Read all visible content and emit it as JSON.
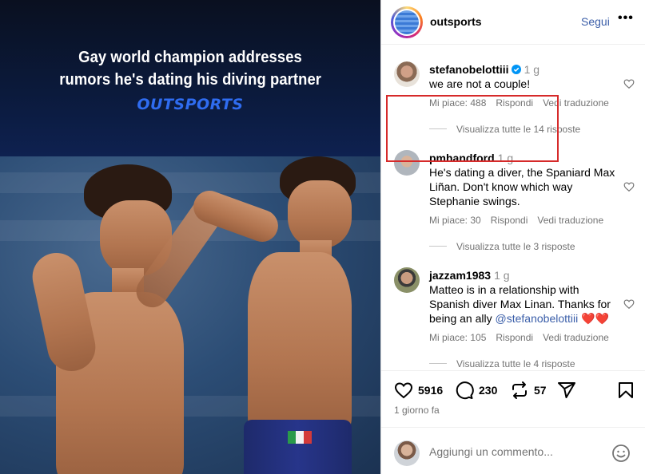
{
  "media": {
    "headline_line1": "Gay world champion addresses",
    "headline_line2": "rumors he's dating his diving partner",
    "brand": "OUTSPORTS"
  },
  "post": {
    "owner": "outsports",
    "follow_label": "Segui",
    "more_label": "•••"
  },
  "comments": [
    {
      "user": "stefanobelottiii",
      "verified": true,
      "time": "1 g",
      "text": "we are not a couple!",
      "likes": "Mi piace: 488",
      "reply": "Rispondi",
      "translate": "Vedi traduzione",
      "view_replies": "Visualizza tutte le 14 risposte"
    },
    {
      "user": "pmhandford",
      "verified": false,
      "time": "1 g",
      "text": "He's dating a diver, the Spaniard Max Liñan. Don't know which way Stephanie swings.",
      "likes": "Mi piace: 30",
      "reply": "Rispondi",
      "translate": "Vedi traduzione",
      "view_replies": "Visualizza tutte le 3 risposte"
    },
    {
      "user": "jazzam1983",
      "verified": false,
      "time": "1 g",
      "text_before": "Matteo is in a relationship with Spanish diver Max Linan. Thanks for being an ally ",
      "mention": "@stefanobelottiii",
      "text_after": " ❤️❤️",
      "likes": "Mi piace: 105",
      "reply": "Rispondi",
      "translate": "Vedi traduzione",
      "view_replies": "Visualizza tutte le 4 risposte"
    }
  ],
  "actions": {
    "likes_count": "5916",
    "comments_count": "230",
    "reposts_count": "57",
    "timestamp": "1 giorno fa"
  },
  "add_comment": {
    "placeholder": "Aggiungi un commento..."
  },
  "icons": {
    "verified": "verified-badge-icon",
    "heart": "heart-icon",
    "comment": "comment-icon",
    "repost": "repost-icon",
    "share": "share-icon",
    "save": "bookmark-icon",
    "emoji": "emoji-icon"
  },
  "colors": {
    "highlight_box": "#d62a2a",
    "link_blue": "#3b5ea8",
    "brand_blue": "#2f6cf0"
  }
}
